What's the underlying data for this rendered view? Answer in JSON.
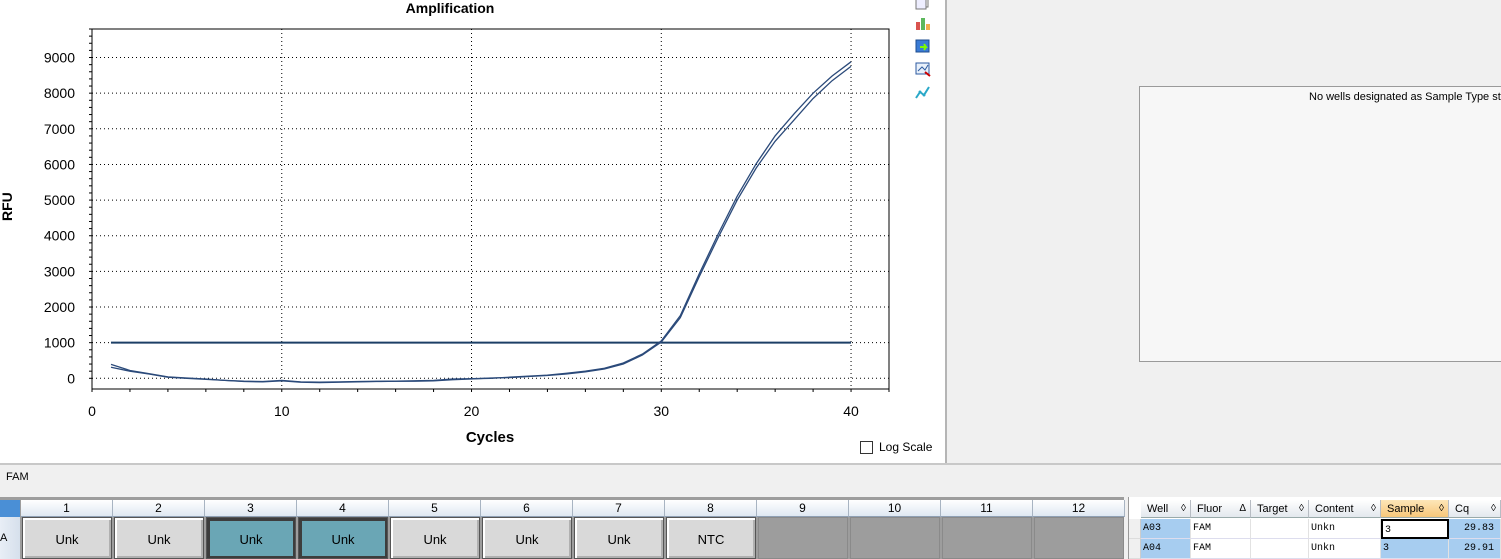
{
  "chart_data": {
    "type": "line",
    "title": "Amplification",
    "xlabel": "Cycles",
    "ylabel": "RFU",
    "xlim": [
      0,
      42
    ],
    "ylim": [
      -300,
      9800
    ],
    "xticks": [
      0,
      10,
      20,
      30,
      40
    ],
    "yticks": [
      0,
      1000,
      2000,
      3000,
      4000,
      5000,
      6000,
      7000,
      8000,
      9000
    ],
    "grid": true,
    "threshold": 1000,
    "x": [
      1,
      2,
      3,
      4,
      5,
      6,
      7,
      8,
      9,
      10,
      11,
      12,
      13,
      14,
      15,
      16,
      17,
      18,
      19,
      20,
      21,
      22,
      23,
      24,
      25,
      26,
      27,
      28,
      29,
      30,
      31,
      32,
      33,
      34,
      35,
      36,
      37,
      38,
      39,
      40
    ],
    "series": [
      {
        "values": [
          390,
          220,
          130,
          40,
          10,
          -20,
          -60,
          -80,
          -90,
          -60,
          -100,
          -110,
          -100,
          -90,
          -85,
          -80,
          -70,
          -60,
          -20,
          -10,
          0,
          30,
          60,
          90,
          140,
          200,
          280,
          430,
          680,
          1050,
          1760,
          2930,
          4050,
          5110,
          6020,
          6800,
          7420,
          8000,
          8480,
          8880
        ]
      },
      {
        "values": [
          310,
          200,
          120,
          30,
          0,
          -30,
          -60,
          -90,
          -100,
          -70,
          -110,
          -120,
          -110,
          -100,
          -90,
          -80,
          -80,
          -70,
          -40,
          -20,
          10,
          20,
          50,
          80,
          120,
          180,
          260,
          400,
          650,
          1020,
          1700,
          2850,
          3950,
          5000,
          5900,
          6650,
          7250,
          7850,
          8350,
          8750
        ]
      }
    ]
  },
  "log_scale_label": "Log Scale",
  "std_message": "No wells designated as Sample Type standard",
  "fluor_label": "FAM",
  "plate": {
    "row_label": "A",
    "columns": [
      "1",
      "2",
      "3",
      "4",
      "5",
      "6",
      "7",
      "8",
      "9",
      "10",
      "11",
      "12"
    ],
    "wells": [
      "Unk",
      "Unk",
      "Unk",
      "Unk",
      "Unk",
      "Unk",
      "Unk",
      "NTC",
      "",
      "",
      "",
      ""
    ]
  },
  "results": {
    "headers": [
      "Well",
      "Fluor",
      "Target",
      "Content",
      "Sample",
      "Cq"
    ],
    "sort_marks": [
      "◊",
      "Δ",
      "◊",
      "◊",
      "◊",
      "◊"
    ],
    "rows": [
      [
        "A03",
        "FAM",
        "",
        "Unkn",
        "3",
        "29.83"
      ],
      [
        "A04",
        "FAM",
        "",
        "Unkn",
        "3",
        "29.91"
      ]
    ]
  },
  "colors": {
    "curve": "#2b4a7a",
    "threshold": "#1c3f66",
    "selected_well": "#6aa6b5",
    "active_header": "#f8c77a"
  },
  "toolbar_icons": [
    "copy-icon",
    "chart-settings-icon",
    "export-icon",
    "zoom-icon",
    "trend-icon"
  ]
}
